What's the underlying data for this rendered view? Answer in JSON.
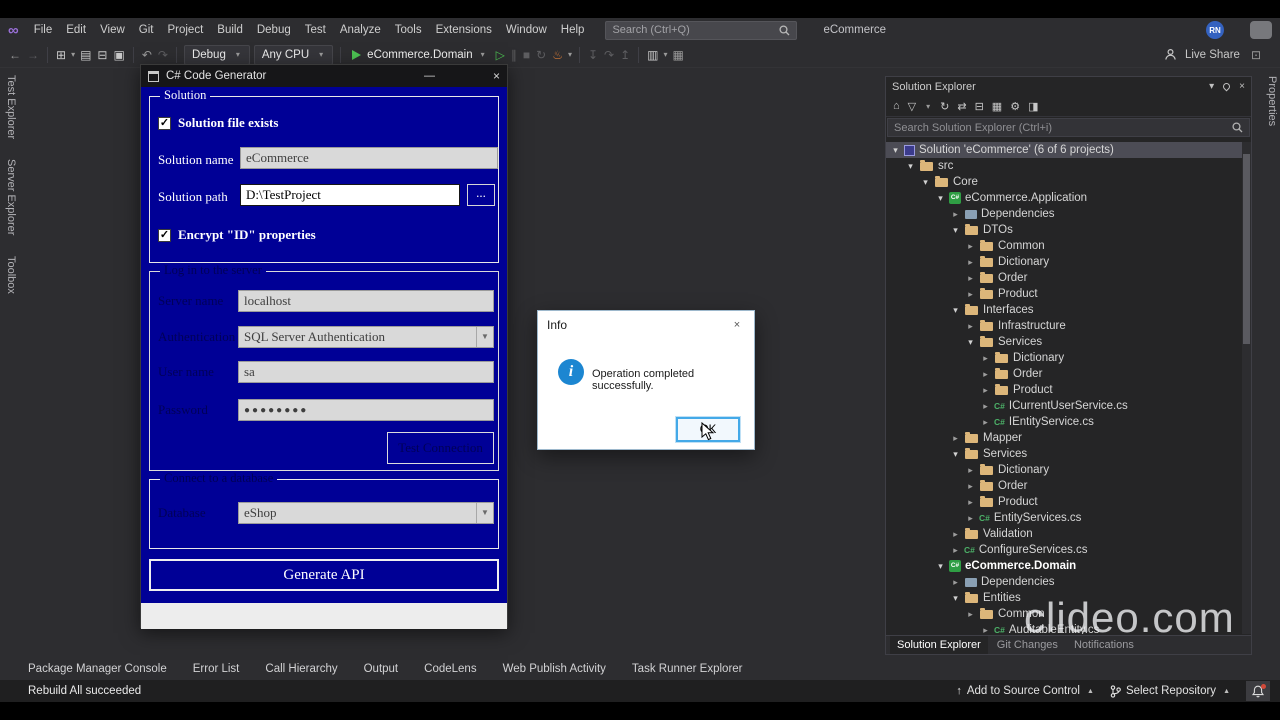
{
  "titlebar": {
    "menu_items": [
      "File",
      "Edit",
      "View",
      "Git",
      "Project",
      "Build",
      "Debug",
      "Test",
      "Analyze",
      "Tools",
      "Extensions",
      "Window",
      "Help"
    ],
    "search_placeholder": "Search (Ctrl+Q)",
    "window_title": "eCommerce",
    "avatar": "RN"
  },
  "toolbar": {
    "config": "Debug",
    "platform": "Any CPU",
    "startup_project": "eCommerce.Domain",
    "live_share": "Live Share"
  },
  "left_tabs": [
    "Test Explorer",
    "Server Explorer",
    "Toolbox"
  ],
  "right_tabs": [
    "Properties"
  ],
  "generator_dialog": {
    "title": "C# Code Generator",
    "minimize": "—",
    "close": "×",
    "solution_group": {
      "label": "Solution",
      "file_exists_label": "Solution file exists",
      "check_glyph": "✓",
      "name_label": "Solution name",
      "name_value": "eCommerce",
      "path_label": "Solution path",
      "path_value": "D:\\TestProject",
      "browse_label": "...",
      "encrypt_label": "Encrypt \"ID\" properties"
    },
    "connection_group": {
      "label": "Log in to the server",
      "server_label": "Server name",
      "server_value": "localhost",
      "auth_label": "Authentication",
      "auth_value": "SQL Server Authentication",
      "user_label": "User name",
      "user_value": "sa",
      "password_label": "Password",
      "password_value": "●●●●●●●●",
      "test_button_label": "Test Connection"
    },
    "database_group": {
      "label": "Connect to a database",
      "db_label": "Database",
      "db_value": "eShop"
    },
    "generate_button_label": "Generate API"
  },
  "info_dialog": {
    "title": "Info",
    "close": "×",
    "message": "Operation completed successfully.",
    "ok_label": "OK"
  },
  "solution_explorer": {
    "title": "Solution Explorer",
    "search_placeholder": "Search Solution Explorer (Ctrl+i)",
    "bottom_tabs": [
      "Solution Explorer",
      "Git Changes",
      "Notifications"
    ],
    "tree": [
      {
        "t": "Solution 'eCommerce' (6 of 6 projects)",
        "l": 0,
        "a": "open",
        "i": "sln",
        "sel": true
      },
      {
        "t": "src",
        "l": 1,
        "a": "open",
        "i": "folder"
      },
      {
        "t": "Core",
        "l": 2,
        "a": "open",
        "i": "folder"
      },
      {
        "t": "eCommerce.Application",
        "l": 3,
        "a": "open",
        "i": "proj"
      },
      {
        "t": "Dependencies",
        "l": 4,
        "a": "closed",
        "i": "dep"
      },
      {
        "t": "DTOs",
        "l": 4,
        "a": "open",
        "i": "folder"
      },
      {
        "t": "Common",
        "l": 5,
        "a": "closed",
        "i": "folder"
      },
      {
        "t": "Dictionary",
        "l": 5,
        "a": "closed",
        "i": "folder"
      },
      {
        "t": "Order",
        "l": 5,
        "a": "closed",
        "i": "folder"
      },
      {
        "t": "Product",
        "l": 5,
        "a": "closed",
        "i": "folder"
      },
      {
        "t": "Interfaces",
        "l": 4,
        "a": "open",
        "i": "folder"
      },
      {
        "t": "Infrastructure",
        "l": 5,
        "a": "closed",
        "i": "folder"
      },
      {
        "t": "Services",
        "l": 5,
        "a": "open",
        "i": "folder"
      },
      {
        "t": "Dictionary",
        "l": 6,
        "a": "closed",
        "i": "folder"
      },
      {
        "t": "Order",
        "l": 6,
        "a": "closed",
        "i": "folder"
      },
      {
        "t": "Product",
        "l": 6,
        "a": "closed",
        "i": "folder"
      },
      {
        "t": "ICurrentUserService.cs",
        "l": 6,
        "a": "closed",
        "i": "cs"
      },
      {
        "t": "IEntityService.cs",
        "l": 6,
        "a": "closed",
        "i": "cs"
      },
      {
        "t": "Mapper",
        "l": 4,
        "a": "closed",
        "i": "folder"
      },
      {
        "t": "Services",
        "l": 4,
        "a": "open",
        "i": "folder"
      },
      {
        "t": "Dictionary",
        "l": 5,
        "a": "closed",
        "i": "folder"
      },
      {
        "t": "Order",
        "l": 5,
        "a": "closed",
        "i": "folder"
      },
      {
        "t": "Product",
        "l": 5,
        "a": "closed",
        "i": "folder"
      },
      {
        "t": "EntityServices.cs",
        "l": 5,
        "a": "closed",
        "i": "cs"
      },
      {
        "t": "Validation",
        "l": 4,
        "a": "closed",
        "i": "folder"
      },
      {
        "t": "ConfigureServices.cs",
        "l": 4,
        "a": "closed",
        "i": "cs"
      },
      {
        "t": "eCommerce.Domain",
        "l": 3,
        "a": "open",
        "i": "proj",
        "bold": true
      },
      {
        "t": "Dependencies",
        "l": 4,
        "a": "closed",
        "i": "dep"
      },
      {
        "t": "Entities",
        "l": 4,
        "a": "open",
        "i": "folder"
      },
      {
        "t": "Common",
        "l": 5,
        "a": "closed",
        "i": "folder"
      },
      {
        "t": "AuditableEntity.cs",
        "l": 6,
        "a": "closed",
        "i": "cs"
      }
    ]
  },
  "bottom_panel_tabs": [
    "Package Manager Console",
    "Error List",
    "Call Hierarchy",
    "Output",
    "CodeLens",
    "Web Publish Activity",
    "Task Runner Explorer"
  ],
  "status_bar": {
    "message": "Rebuild All succeeded",
    "add_to_source_control": "Add to Source Control",
    "select_repository": "Select Repository"
  },
  "watermark": "clideo.com",
  "colors": {
    "dialog_bg": "#000096",
    "run_green": "#4cc152",
    "folder": "#dcb67a"
  }
}
